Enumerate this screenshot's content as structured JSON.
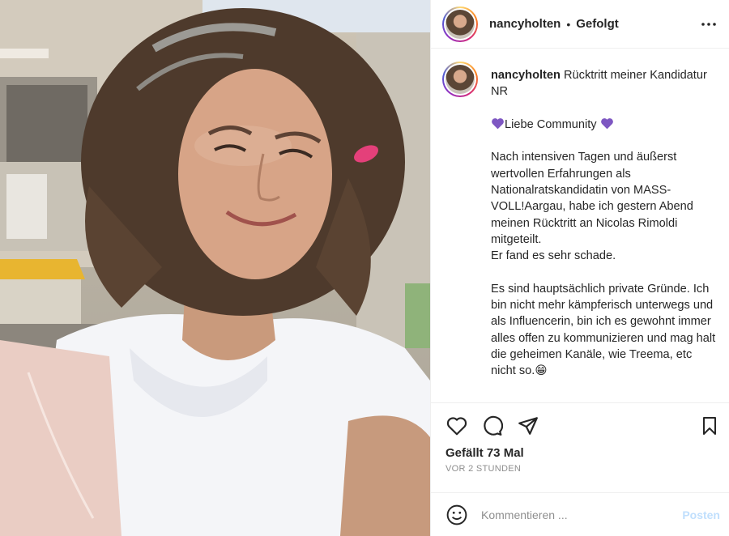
{
  "header": {
    "username": "nancyholten",
    "separator": "•",
    "follow_state": "Gefolgt"
  },
  "caption": {
    "username": "nancyholten",
    "title": " Rücktritt meiner Kandidatur NR",
    "greeting": "Liebe Community",
    "body": "Nach intensiven Tagen und äußerst wertvollen Erfahrungen als Nationalratskandidatin von MASS-VOLL!Aargau, habe ich gestern Abend meinen Rücktritt an Nicolas Rimoldi mitgeteilt.\nEr fand es sehr schade.\n\nEs sind hauptsächlich private Gründe. Ich bin nicht mehr kämpferisch unterwegs und als Influencerin, bin ich es gewohnt immer alles offen zu kommunizieren und mag halt die geheimen Kanäle, wie Treema, etc nicht so.😁"
  },
  "stats": {
    "likes_label": "Gefällt 73 Mal",
    "time_label": "VOR 2 STUNDEN"
  },
  "comment": {
    "placeholder": "Kommentieren ...",
    "post_label": "Posten"
  },
  "icons": {
    "like": "heart-icon",
    "comment": "comment-icon",
    "share": "share-icon",
    "save": "bookmark-icon",
    "more": "more-options-icon",
    "emoji": "emoji-icon",
    "greeting_emoji": "purple-heart-icon"
  },
  "colors": {
    "purple_heart": "#7e57c2",
    "post_button_disabled": "#c0dffd",
    "secondary_text": "#8e8e8e"
  }
}
